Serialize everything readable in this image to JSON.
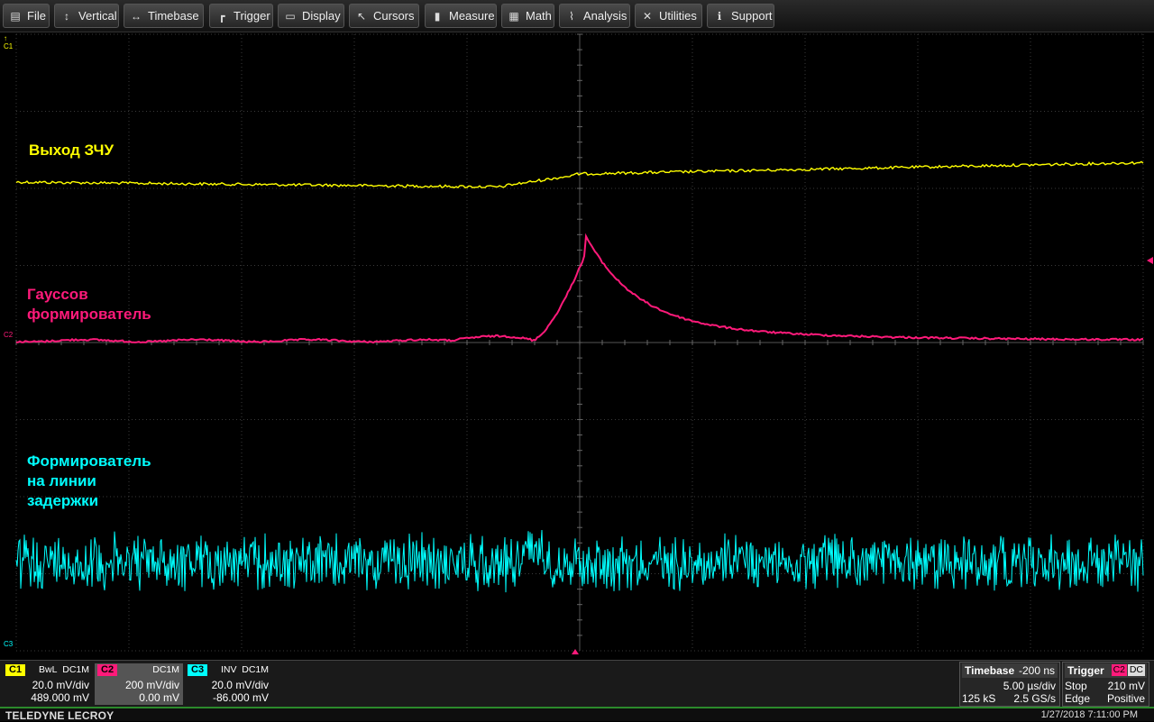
{
  "menu": [
    {
      "label": "File",
      "icon": "file-icon"
    },
    {
      "label": "Vertical",
      "icon": "vertical-icon"
    },
    {
      "label": "Timebase",
      "icon": "timebase-icon"
    },
    {
      "label": "Trigger",
      "icon": "trigger-icon"
    },
    {
      "label": "Display",
      "icon": "display-icon"
    },
    {
      "label": "Cursors",
      "icon": "cursors-icon"
    },
    {
      "label": "Measure",
      "icon": "measure-icon"
    },
    {
      "label": "Math",
      "icon": "math-icon"
    },
    {
      "label": "Analysis",
      "icon": "analysis-icon"
    },
    {
      "label": "Utilities",
      "icon": "utilities-icon"
    },
    {
      "label": "Support",
      "icon": "support-icon"
    }
  ],
  "traces": {
    "c1": {
      "label": "Выход ЗЧУ",
      "marker": "C1",
      "color": "#ffff00"
    },
    "c2": {
      "label_line1": "Гауссов",
      "label_line2": "формирователь",
      "marker": "C2",
      "color": "#ff1a7a"
    },
    "c3": {
      "label_line1": "Формирователь",
      "label_line2": "на линии",
      "label_line3": "задержки",
      "marker": "C3",
      "color": "#00ffff"
    }
  },
  "channels": [
    {
      "tag": "C1",
      "bwl": "BwL",
      "coupling": "DC1M",
      "vdiv": "20.0 mV/div",
      "offset": "489.000 mV",
      "color": "#ffff00"
    },
    {
      "tag": "C2",
      "bwl": "",
      "coupling": "DC1M",
      "vdiv": "200 mV/div",
      "offset": "0.00 mV",
      "color": "#ff1a7a"
    },
    {
      "tag": "C3",
      "bwl": "INV",
      "coupling": "DC1M",
      "vdiv": "20.0 mV/div",
      "offset": "-86.000 mV",
      "color": "#00ffff"
    }
  ],
  "timebase": {
    "title": "Timebase",
    "delay": "-200 ns",
    "tdiv": "5.00 µs/div",
    "samples": "125 kS",
    "rate": "2.5 GS/s"
  },
  "trigger": {
    "title": "Trigger",
    "source": "C2",
    "coupling": "DC",
    "mode": "Stop",
    "level": "210 mV",
    "type": "Edge",
    "slope": "Positive"
  },
  "status": {
    "brand": "TELEDYNE LECROY",
    "datetime": "1/27/2018 7:11:00 PM"
  }
}
